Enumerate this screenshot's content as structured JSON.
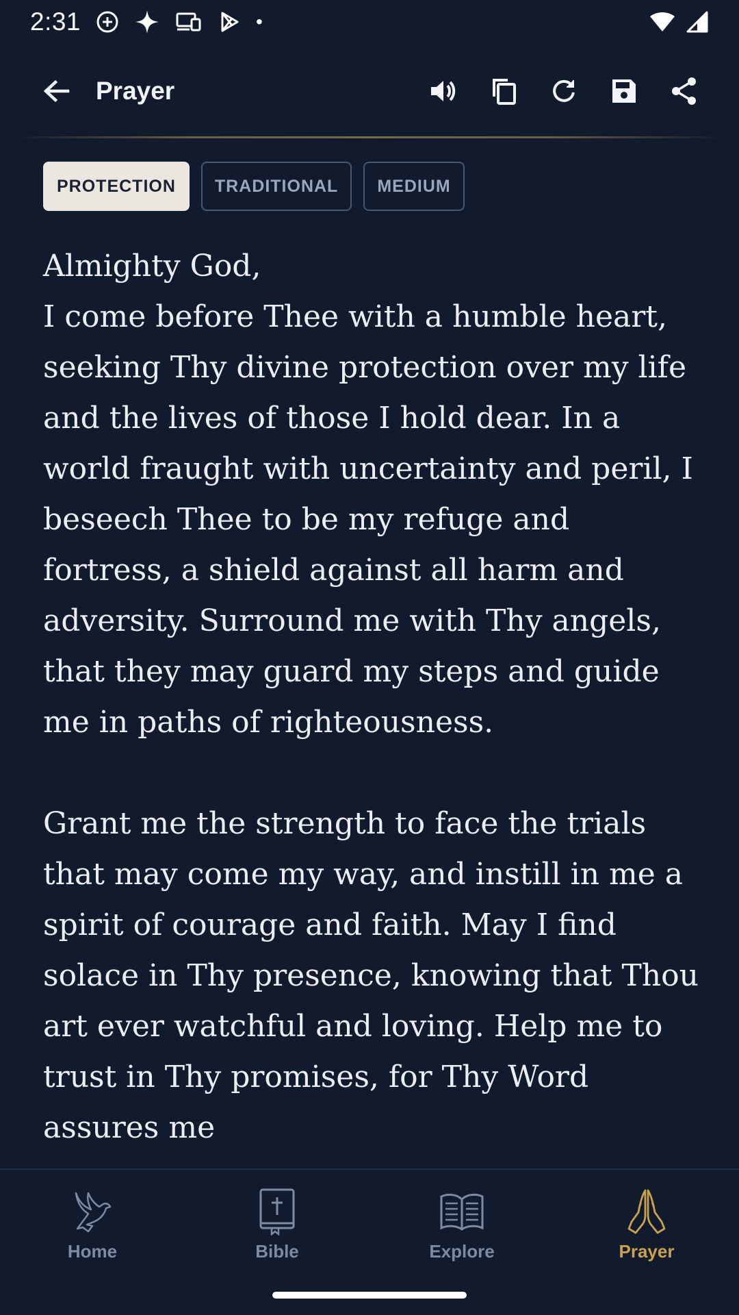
{
  "status_bar": {
    "time": "2:31",
    "dot": "•"
  },
  "app_bar": {
    "title": "Prayer"
  },
  "tags": [
    {
      "label": "PROTECTION",
      "active": true
    },
    {
      "label": "TRADITIONAL",
      "active": false
    },
    {
      "label": "MEDIUM",
      "active": false
    }
  ],
  "prayer": {
    "paragraphs": [
      "Almighty God,\nI come before Thee with a humble heart, seeking Thy divine protection over my life and the lives of those I hold dear. In a world fraught with uncertainty and peril, I beseech Thee to be my refuge and fortress, a shield against all harm and adversity. Surround me with Thy angels, that they may guard my steps and guide me in paths of righteousness.",
      "Grant me the strength to face the trials that may come my way, and instill in me a spirit of courage and faith. May I find solace in Thy presence, knowing that Thou art ever watchful and loving. Help me to trust in Thy promises, for Thy Word assures me"
    ]
  },
  "bottom_nav": {
    "items": [
      {
        "label": "Home",
        "icon": "dove-icon",
        "active": false
      },
      {
        "label": "Bible",
        "icon": "bible-icon",
        "active": false
      },
      {
        "label": "Explore",
        "icon": "open-book-icon",
        "active": false
      },
      {
        "label": "Prayer",
        "icon": "praying-hands-icon",
        "active": true
      }
    ]
  },
  "colors": {
    "background": "#121a2d",
    "accent": "#c9a24e",
    "inactive": "#7d8aa2",
    "tag_active_bg": "#ebe6df"
  }
}
